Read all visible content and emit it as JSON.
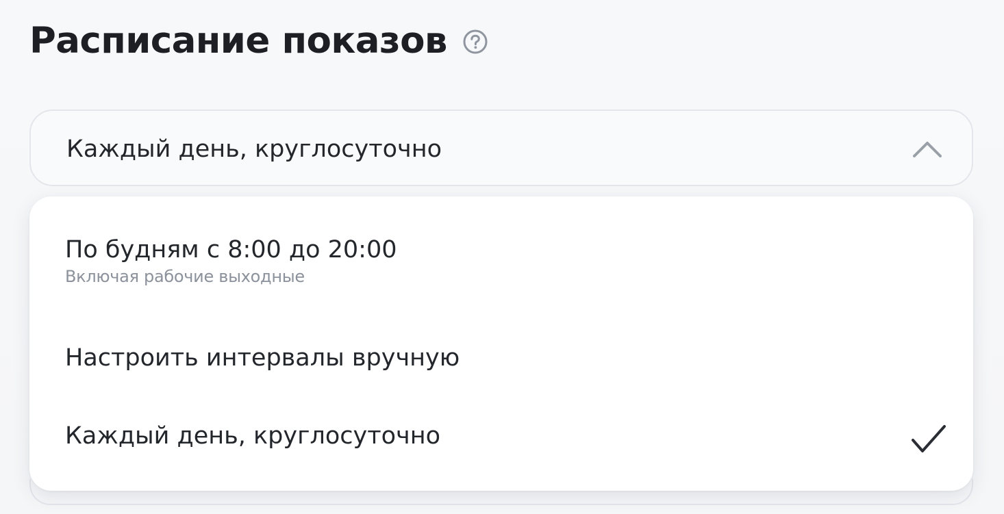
{
  "section": {
    "title": "Расписание показов",
    "help_icon": "question-circle-icon"
  },
  "select": {
    "value": "Каждый день, круглосуточно",
    "chevron_icon": "chevron-up-icon",
    "expanded": true
  },
  "options": [
    {
      "label": "По будням с 8:00 до 20:00",
      "sublabel": "Включая рабочие выходные",
      "selected": false
    },
    {
      "label": "Настроить интервалы вручную",
      "selected": false
    },
    {
      "label": "Каждый день, круглосуточно",
      "selected": true,
      "check_icon": "checkmark-icon"
    }
  ],
  "colors": {
    "text": "#23262b",
    "muted": "#8c929b",
    "border": "#e3e6eb",
    "icon": "#8f959e"
  }
}
